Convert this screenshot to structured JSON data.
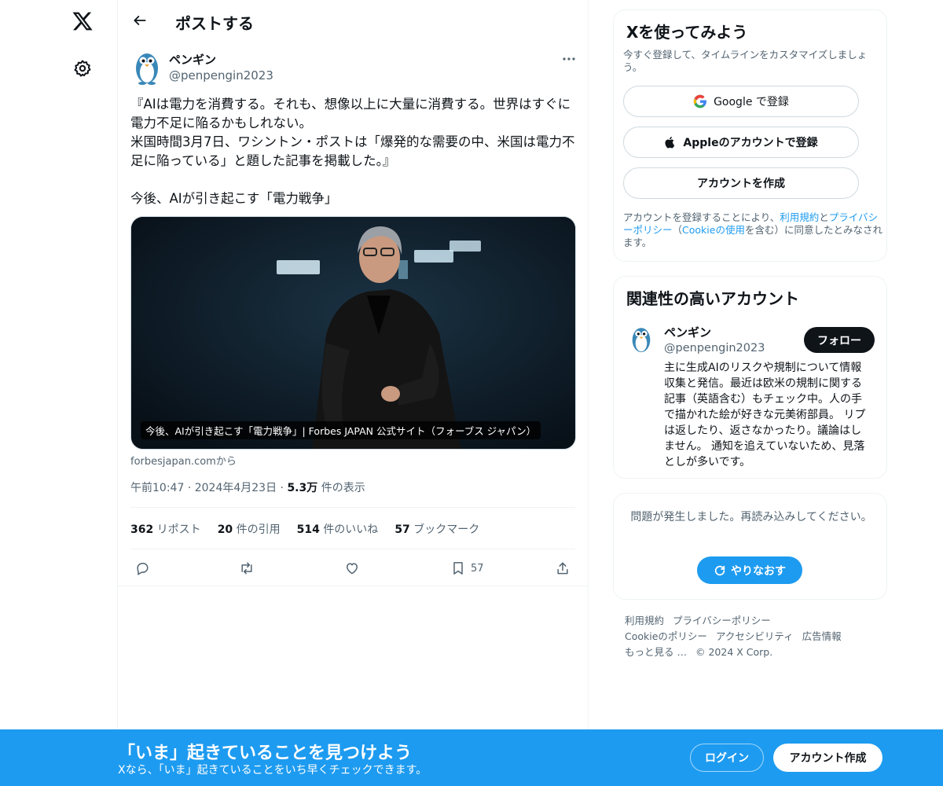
{
  "nav": {
    "logo_icon": "x-logo-icon",
    "settings_icon": "gear-icon"
  },
  "header": {
    "back_icon": "arrow-left-icon",
    "title": "ポストする"
  },
  "post": {
    "author_name": "ペンギン",
    "author_handle": "@penpengin2023",
    "text": "『AIは電力を消費する。それも、想像以上に大量に消費する。世界はすぐに電力不足に陥るかもしれない。\n米国時間3月7日、ワシントン・ポストは「爆発的な需要の中、米国は電力不足に陥っている」と題した記事を掲載した。』\n\n今後、AIが引き起こす「電力戦争」",
    "card_caption": "今後、AIが引き起こす「電力戦争」| Forbes JAPAN 公式サイト（フォーブス ジャパン）",
    "card_source": "forbesjapan.comから",
    "time": "午前10:47",
    "date": "2024年4月23日",
    "views_count": "5.3万",
    "views_label": "件の表示",
    "stats": {
      "reposts_count": "362",
      "reposts_label": "リポスト",
      "quotes_count": "20",
      "quotes_label": "件の引用",
      "likes_count": "514",
      "likes_label": "件のいいね",
      "bookmarks_count": "57",
      "bookmarks_label": "ブックマーク"
    },
    "actions": {
      "bookmark_count": "57"
    }
  },
  "signup_box": {
    "title": "Xを使ってみよう",
    "subtitle": "今すぐ登録して、タイムラインをカスタマイズしましょう。",
    "google_label": "Google で登録",
    "apple_label": "Appleのアカウントで登録",
    "create_label": "アカウントを作成",
    "legal_prefix": "アカウントを登録することにより、",
    "terms_link": "利用規約",
    "and": "と",
    "privacy_link": "プライバシーポリシー",
    "cookie_open": "（",
    "cookie_link": "Cookieの使用",
    "legal_suffix": "を含む）に同意したとみなされます。"
  },
  "related": {
    "title": "関連性の高いアカウント",
    "name": "ペンギン",
    "handle": "@penpengin2023",
    "follow_label": "フォロー",
    "bio": "主に生成AIのリスクや規制について情報収集と発信。最近は欧米の規制に関する記事（英語含む）もチェック中。人の手で描かれた絵が好きな元美術部員。 リプは返したり、返さなかったり。議論はしません。 通知を追えていないため、見落としが多いです。"
  },
  "error_box": {
    "message": "問題が発生しました。再読み込みしてください。",
    "retry_label": "やりなおす"
  },
  "footer": {
    "terms": "利用規約",
    "privacy": "プライバシーポリシー",
    "cookie": "Cookieのポリシー",
    "accessibility": "アクセシビリティ",
    "ads": "広告情報",
    "more": "もっと見る …",
    "copyright": "© 2024 X Corp."
  },
  "bottom_bar": {
    "title": "「いま」起きていることを見つけよう",
    "subtitle": "Xなら、「いま」起きていることをいち早くチェックできます。",
    "login_label": "ログイン",
    "signup_label": "アカウント作成"
  },
  "colors": {
    "accent": "#1d9bf0",
    "text": "#0f1419",
    "muted": "#536471"
  }
}
